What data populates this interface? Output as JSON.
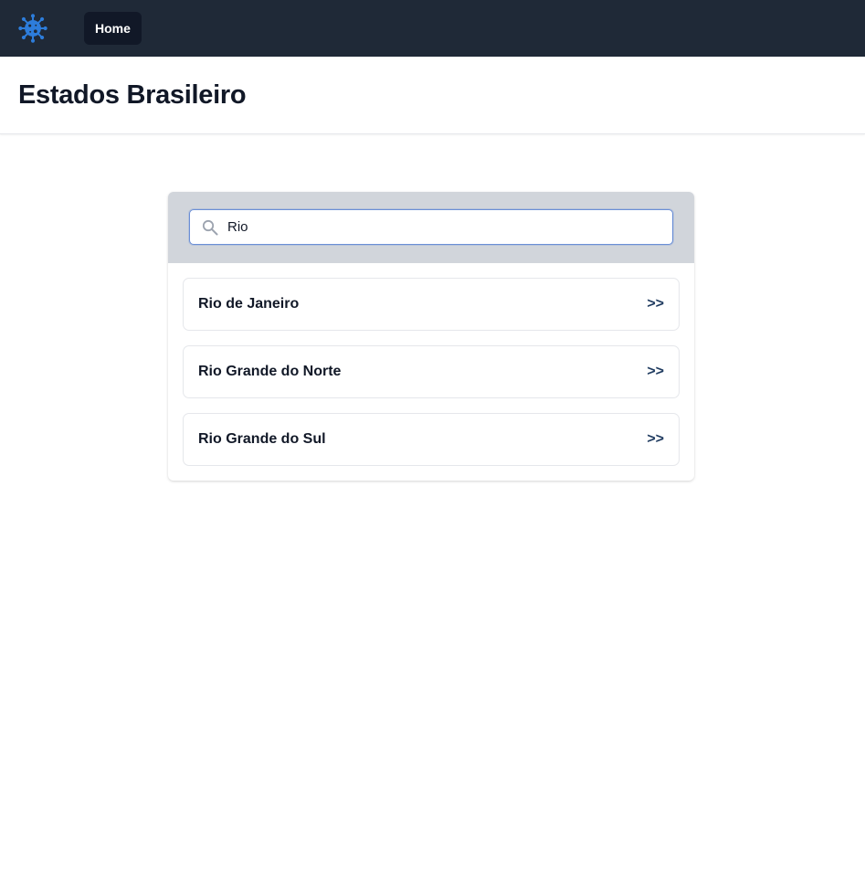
{
  "navbar": {
    "logo_icon": "virus-icon",
    "logo_color": "#2d7ddb",
    "links": [
      {
        "label": "Home"
      }
    ]
  },
  "header": {
    "title": "Estados Brasileiro"
  },
  "search": {
    "icon": "search-icon",
    "value": "Rio",
    "placeholder": ""
  },
  "results": {
    "items": [
      {
        "label": "Rio de Janeiro",
        "arrow": ">>"
      },
      {
        "label": "Rio Grande do Norte",
        "arrow": ">>"
      },
      {
        "label": "Rio Grande do Sul",
        "arrow": ">>"
      }
    ]
  },
  "colors": {
    "navbar_bg": "#1f2937",
    "search_area_bg": "#d1d5db",
    "accent": "#2d7ddb"
  }
}
